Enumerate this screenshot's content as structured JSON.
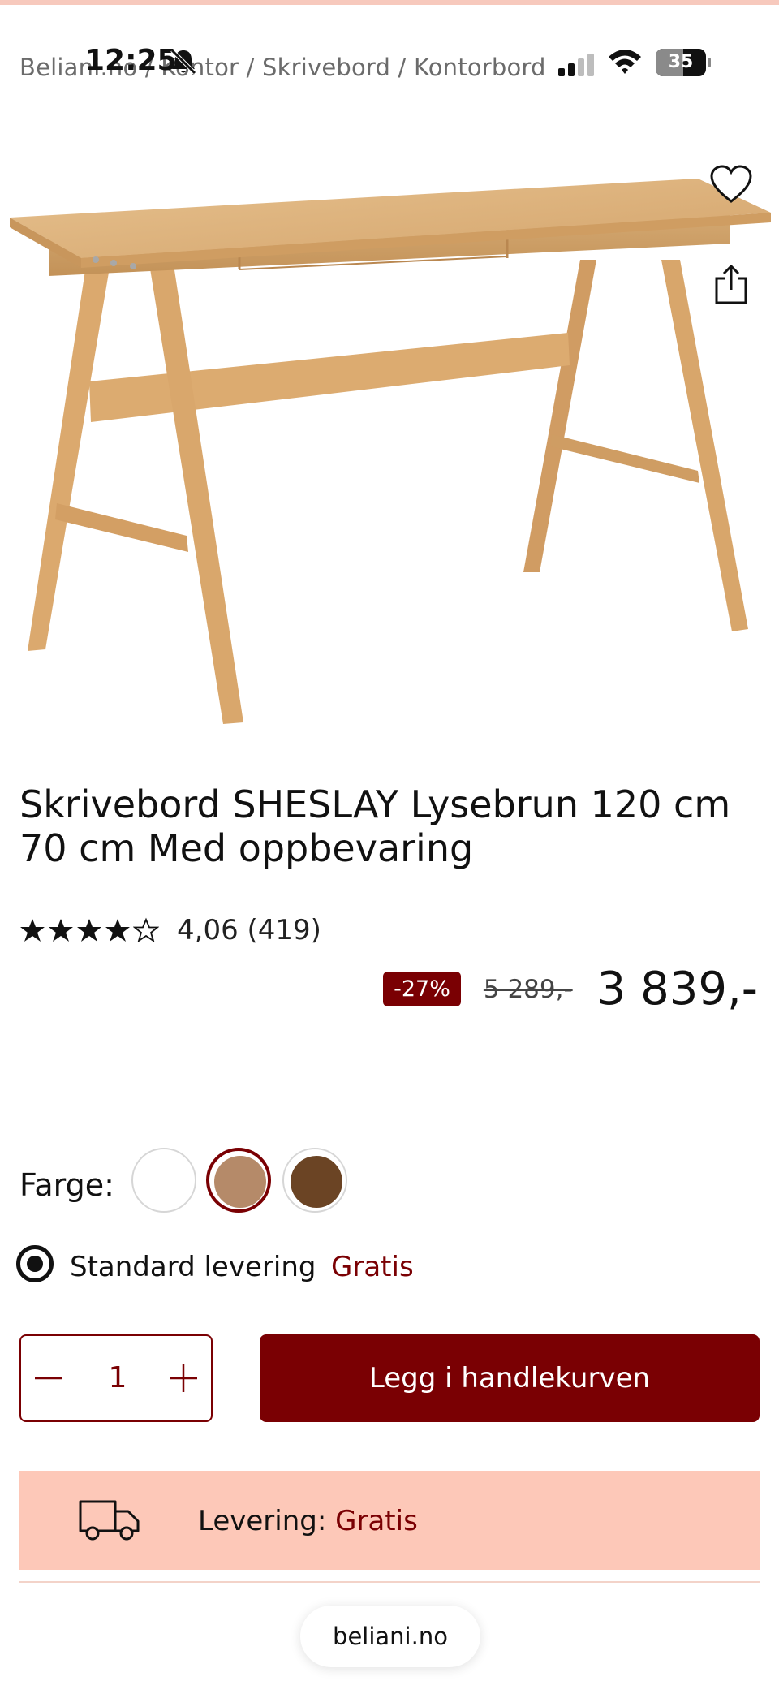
{
  "status_bar": {
    "time": "12:25",
    "battery": "35"
  },
  "breadcrumb": [
    "Beliani.no",
    "Kontor",
    "Skrivebord",
    "Kontorbord"
  ],
  "breadcrumb_sep": " / ",
  "product": {
    "title": "Skrivebord SHESLAY Lysebrun 120 cm 70 cm Med oppbevaring",
    "rating": {
      "stars": 4,
      "text": "4,06 (419)"
    },
    "discount": "-27%",
    "old_price": "5 289,-",
    "price": "3 839,-"
  },
  "colors": {
    "label": "Farge:",
    "options": [
      "#ffffff",
      "#b58a69",
      "#6b4424"
    ],
    "selected_index": 1,
    "accent": "#7a0003"
  },
  "shipping": {
    "label": "Standard levering",
    "price": "Gratis"
  },
  "quantity": {
    "value": "1"
  },
  "add_to_cart": "Legg i handlekurven",
  "banner": {
    "label": "Levering:",
    "value": "Gratis"
  },
  "url": "beliani.no",
  "icons": [
    "bell-muted-icon",
    "signal-icon",
    "wifi-icon",
    "heart-icon",
    "share-icon",
    "minus-icon",
    "plus-icon",
    "truck-icon",
    "star-icon"
  ]
}
